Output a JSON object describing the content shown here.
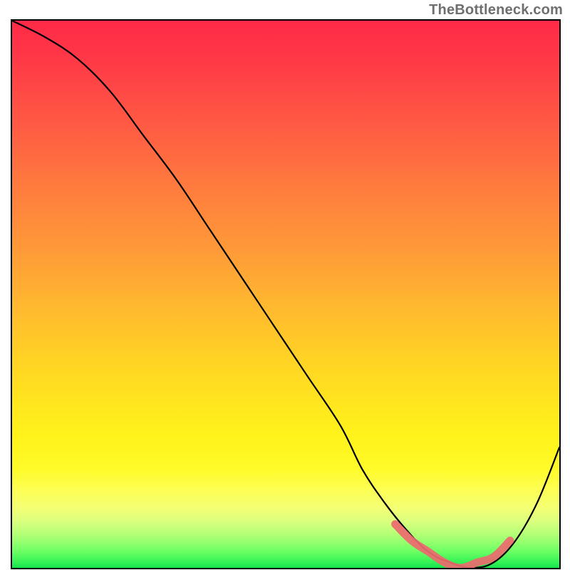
{
  "watermark": "TheBottleneck.com",
  "chart_data": {
    "type": "line",
    "title": "",
    "xlabel": "",
    "ylabel": "",
    "xlim": [
      0,
      100
    ],
    "ylim": [
      0,
      100
    ],
    "series": [
      {
        "name": "bottleneck-curve",
        "x": [
          0,
          6,
          12,
          18,
          24,
          30,
          36,
          42,
          48,
          54,
          60,
          64,
          68,
          72,
          76,
          80,
          84,
          88,
          92,
          96,
          100
        ],
        "values": [
          100,
          97,
          93,
          87,
          79,
          71,
          62,
          53,
          44,
          35,
          26,
          18,
          12,
          7,
          3,
          1,
          0,
          1,
          5,
          12,
          22
        ]
      }
    ],
    "highlight": {
      "name": "optimal-range",
      "x": [
        70,
        73,
        76,
        79,
        82,
        85,
        88,
        91
      ],
      "values": [
        8,
        5,
        3,
        1,
        0,
        1,
        2,
        5
      ]
    }
  }
}
